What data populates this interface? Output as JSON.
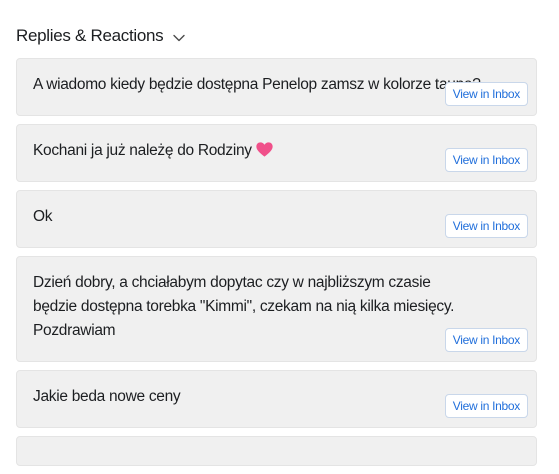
{
  "section": {
    "title": "Replies & Reactions",
    "toggle_icon": "chevron-down-icon"
  },
  "replies": [
    {
      "text": "A wiadomo kiedy będzie dostępna Penelop zamsz w kolorze taupe?",
      "action_label": "View in Inbox"
    },
    {
      "text": "Kochani ja już należę do Rodziny",
      "emoji": "heart-icon",
      "emoji_color": "#f0508a",
      "action_label": "View in Inbox"
    },
    {
      "text": "Ok",
      "action_label": "View in Inbox"
    },
    {
      "text": "Dzień dobry, a chciałabym dopytac czy w najbliższym czasie będzie dostępna torebka \"Kimmi\", czekam na nią kilka miesięcy.\nPozdrawiam",
      "action_label": "View in Inbox"
    },
    {
      "text": "Jakie beda nowe ceny",
      "action_label": "View in Inbox"
    }
  ],
  "colors": {
    "link_blue": "#216fdb",
    "card_background": "#f0f0f0"
  }
}
